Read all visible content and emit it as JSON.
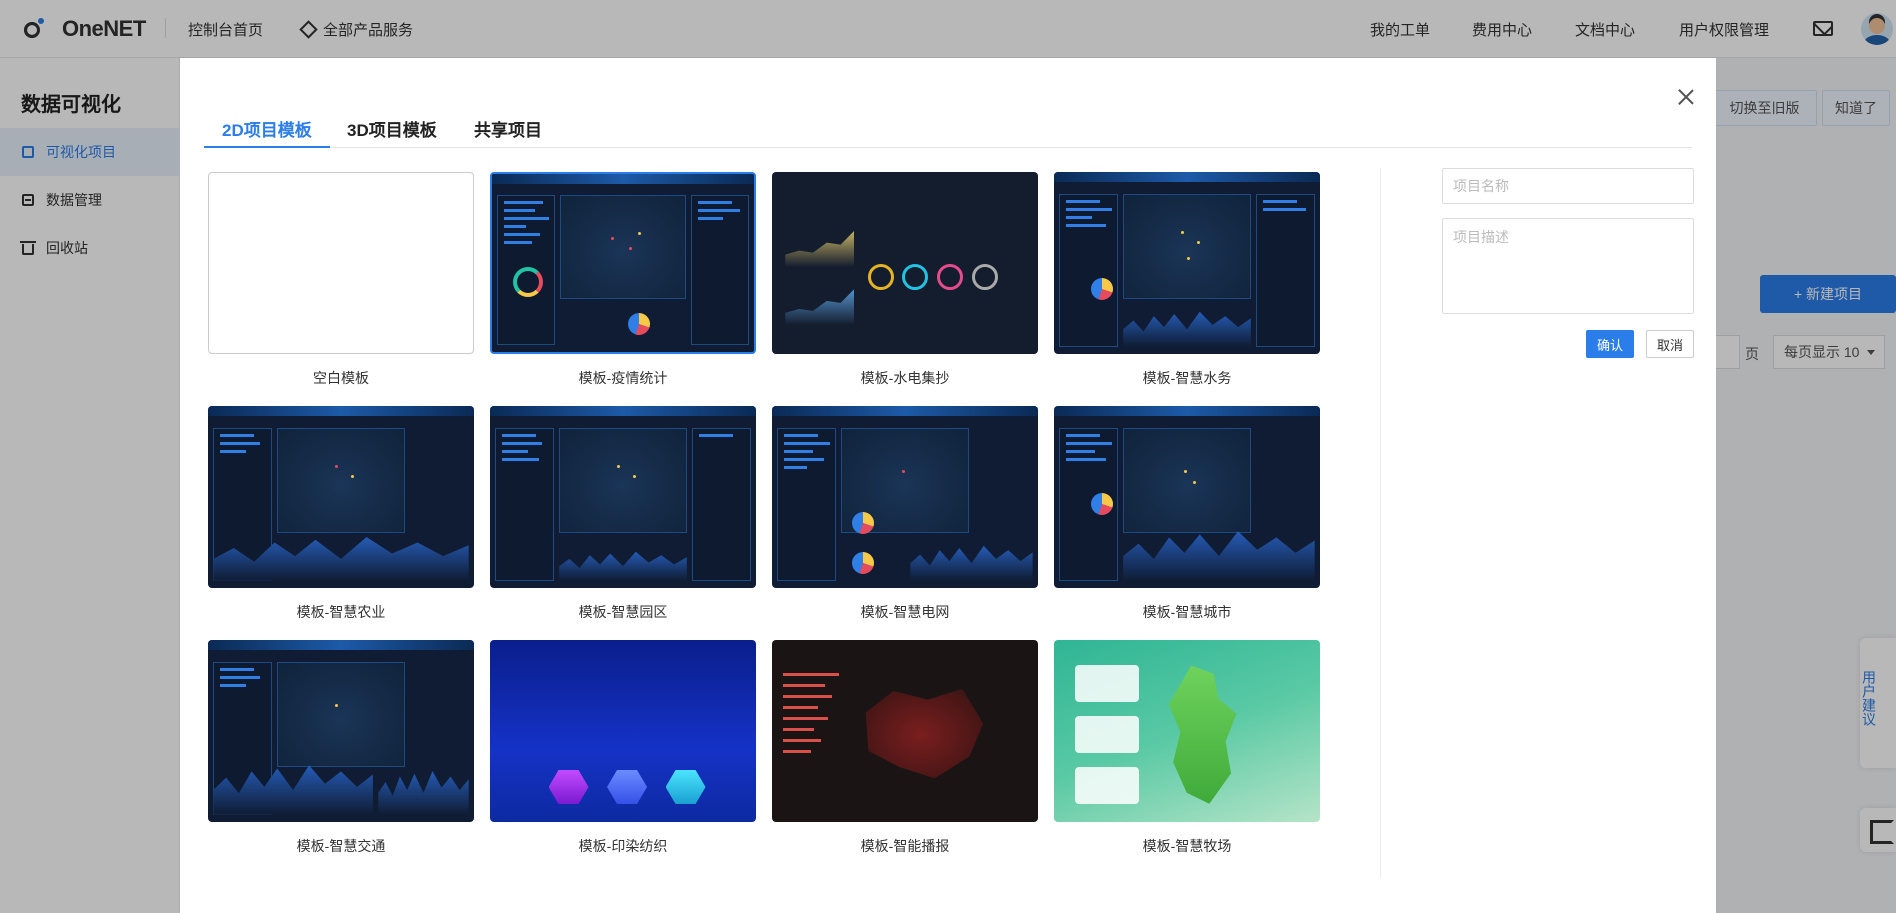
{
  "topbar": {
    "logo_text": "OneNET",
    "home": "控制台首页",
    "products": "全部产品服务",
    "links": [
      "我的工单",
      "费用中心",
      "文档中心",
      "用户权限管理"
    ]
  },
  "sidebar": {
    "title": "数据可视化",
    "items": [
      {
        "label": "可视化项目",
        "icon": "grid-icon"
      },
      {
        "label": "数据管理",
        "icon": "database-icon"
      },
      {
        "label": "回收站",
        "icon": "trash-icon"
      }
    ]
  },
  "background": {
    "switch_old": "切换至旧版",
    "got_it": "知道了",
    "new_project": "+ 新建项目",
    "page_suffix": "页",
    "page_size": "每页显示 10",
    "feedback": "用户建议"
  },
  "modal": {
    "tabs": [
      "2D项目模板",
      "3D项目模板",
      "共享项目"
    ],
    "templates": [
      "空白模板",
      "模板-疫情统计",
      "模板-水电集抄",
      "模板-智慧水务",
      "模板-智慧农业",
      "模板-智慧园区",
      "模板-智慧电网",
      "模板-智慧城市",
      "模板-智慧交通",
      "模板-印染纺织",
      "模板-智能播报",
      "模板-智慧牧场"
    ],
    "form": {
      "name_placeholder": "项目名称",
      "desc_placeholder": "项目描述",
      "confirm": "确认",
      "cancel": "取消"
    }
  },
  "colors": {
    "accent": "#2b7de9"
  }
}
